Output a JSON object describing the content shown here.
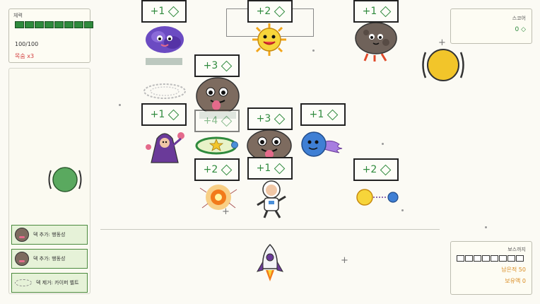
{
  "hp_panel": {
    "title": "체력",
    "value": "100/100",
    "lives": "목숨 x3",
    "segments": 8
  },
  "score_panel": {
    "title": "스코어",
    "value": "0 ◇"
  },
  "boss_panel": {
    "title": "보스까지",
    "segments": 10,
    "remaining": "남은적 50",
    "reward": "보유액 0"
  },
  "deck": [
    {
      "label": "덱 추가: 행동성"
    },
    {
      "label": "덱 추가: 행동성"
    },
    {
      "label": "덱 제거: 카이퍼 벨트"
    }
  ],
  "badges": [
    {
      "text": "+1"
    },
    {
      "text": "+2"
    },
    {
      "text": "+1"
    },
    {
      "text": "+3"
    },
    {
      "text": "+1"
    },
    {
      "text": "+4"
    },
    {
      "text": "+3"
    },
    {
      "text": "+1"
    },
    {
      "text": "+2"
    },
    {
      "text": "+1"
    },
    {
      "text": "+2"
    }
  ],
  "colors": {
    "accent_green": "#2f8a3d",
    "hp_red": "#d23c3c",
    "boss_orange": "#d98a1f",
    "sun_yellow": "#f2c52a"
  }
}
